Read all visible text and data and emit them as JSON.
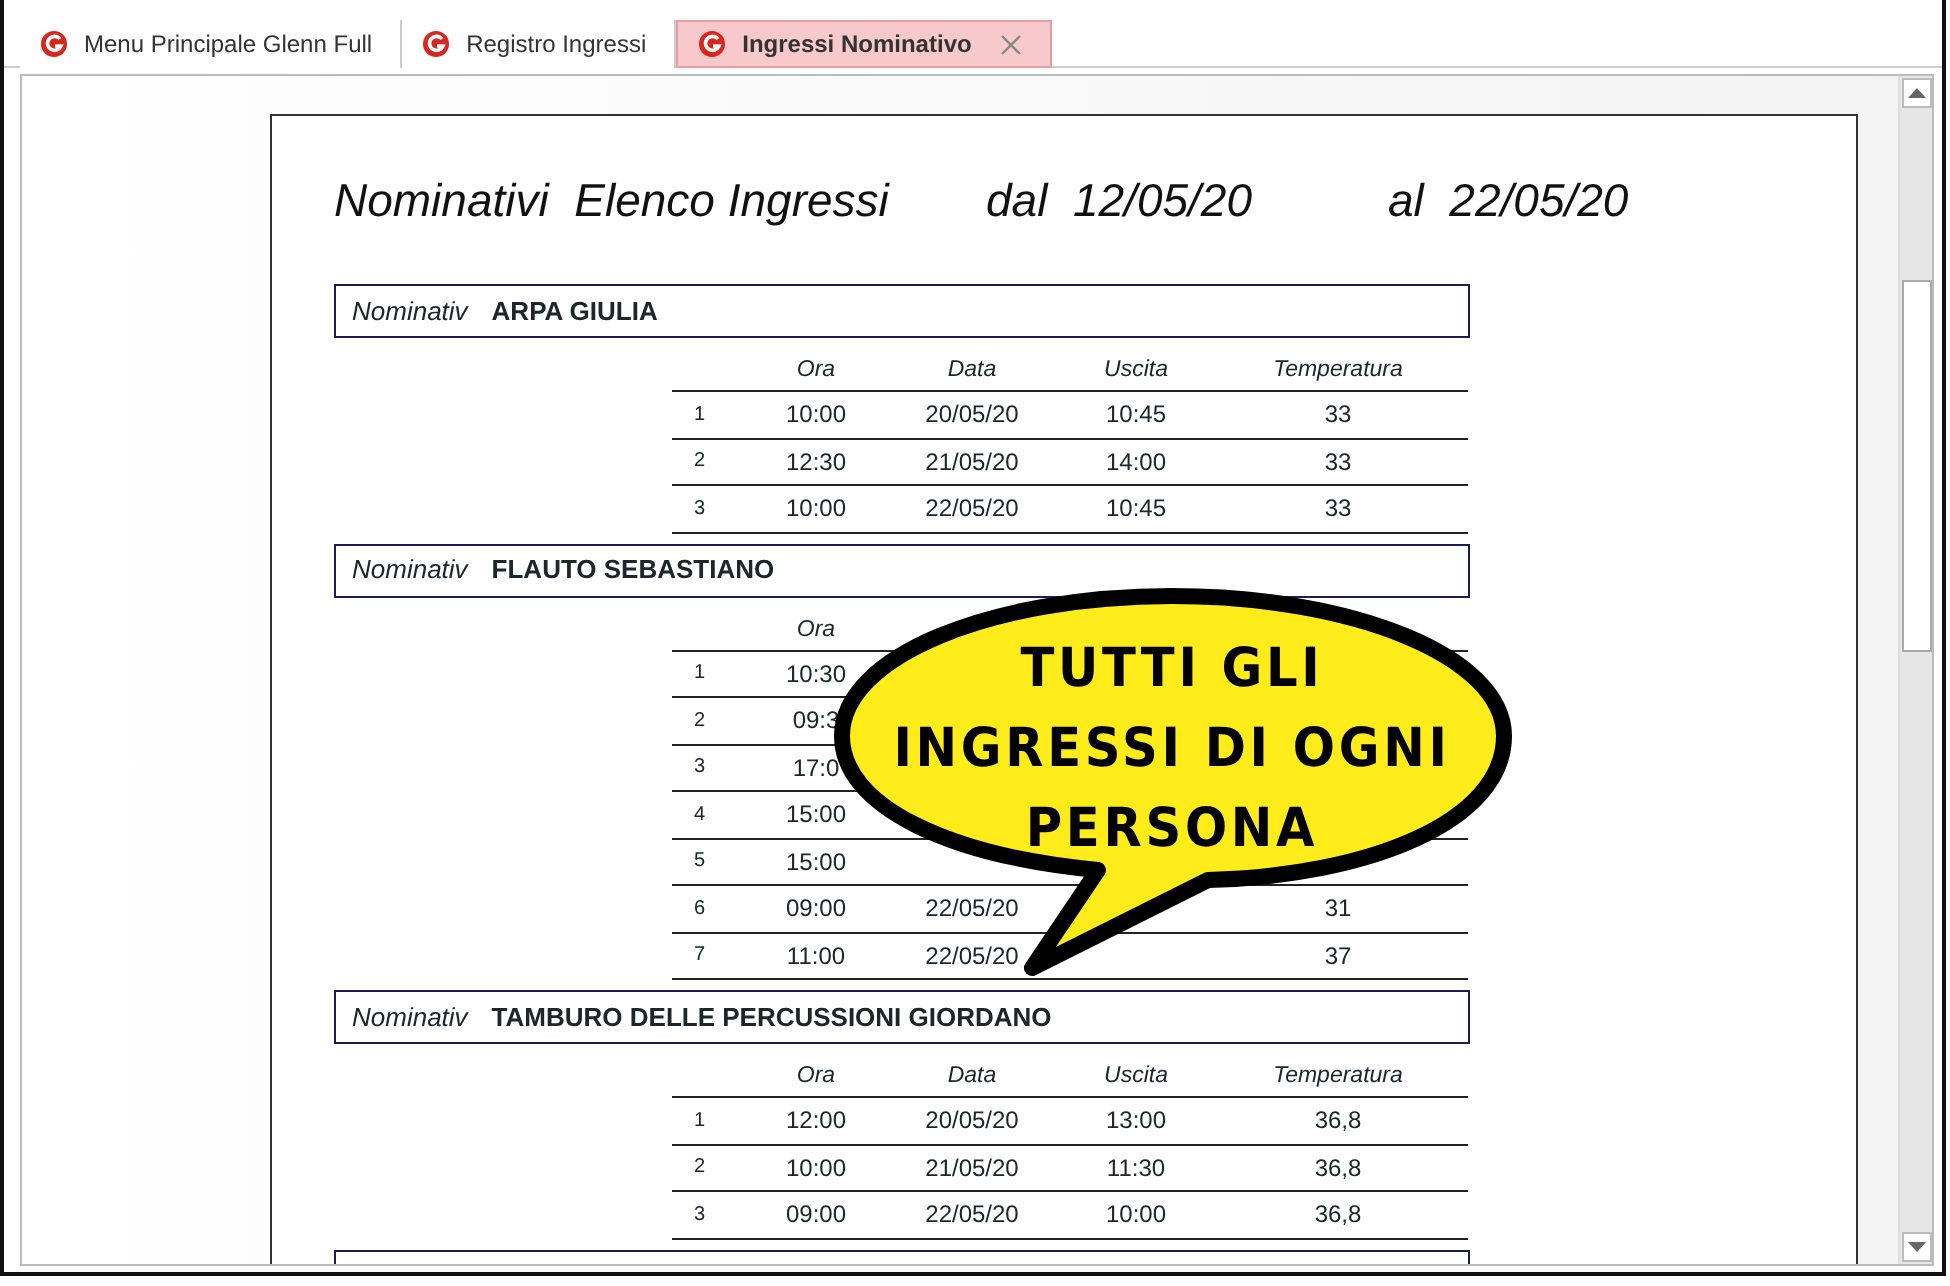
{
  "tabs": [
    {
      "label": "Menu Principale Glenn Full",
      "selected": false,
      "closable": false
    },
    {
      "label": "Registro Ingressi",
      "selected": false,
      "closable": false
    },
    {
      "label": "Ingressi Nominativo",
      "selected": true,
      "closable": true
    }
  ],
  "report": {
    "title": {
      "subject": "Nominativi  Elenco Ingressi",
      "from": "dal  12/05/20",
      "to": "al  22/05/20"
    },
    "groups": [
      {
        "label": "Nominativ",
        "name": "ARPA GIULIA",
        "columns": [
          "Ora",
          "Data",
          "Uscita",
          "Temperatura"
        ],
        "rows": [
          {
            "number": "1",
            "cells": [
              "10:00",
              "20/05/20",
              "10:45",
              "33"
            ]
          },
          {
            "number": "2",
            "cells": [
              "12:30",
              "21/05/20",
              "14:00",
              "33"
            ]
          },
          {
            "number": "3",
            "cells": [
              "10:00",
              "22/05/20",
              "10:45",
              "33"
            ]
          }
        ]
      },
      {
        "label": "Nominativ",
        "name": "FLAUTO SEBASTIANO",
        "columns": [
          "Ora",
          null,
          null,
          null
        ],
        "rows": [
          {
            "number": "1",
            "cells": [
              "10:30",
              null,
              null,
              null
            ]
          },
          {
            "number": "2",
            "cells": [
              "09:3",
              null,
              null,
              null
            ]
          },
          {
            "number": "3",
            "cells": [
              "17:0",
              null,
              null,
              null
            ]
          },
          {
            "number": "4",
            "cells": [
              "15:00",
              null,
              null,
              null
            ]
          },
          {
            "number": "5",
            "cells": [
              "15:00",
              null,
              null,
              null
            ]
          },
          {
            "number": "6",
            "cells": [
              "09:00",
              "22/05/20",
              null,
              "31"
            ]
          },
          {
            "number": "7",
            "cells": [
              "11:00",
              "22/05/20",
              null,
              "37"
            ]
          }
        ]
      },
      {
        "label": "Nominativ",
        "name": "TAMBURO DELLE PERCUSSIONI GIORDANO",
        "columns": [
          "Ora",
          "Data",
          "Uscita",
          "Temperatura"
        ],
        "rows": [
          {
            "number": "1",
            "cells": [
              "12:00",
              "20/05/20",
              "13:00",
              "36,8"
            ]
          },
          {
            "number": "2",
            "cells": [
              "10:00",
              "21/05/20",
              "11:30",
              "36,8"
            ]
          },
          {
            "number": "3",
            "cells": [
              "09:00",
              "22/05/20",
              "10:00",
              "36,8"
            ]
          }
        ]
      }
    ]
  },
  "callout": {
    "lines": [
      "TUTTI GLI",
      "INGRESSI DI OGNI",
      "PERSONA"
    ]
  }
}
